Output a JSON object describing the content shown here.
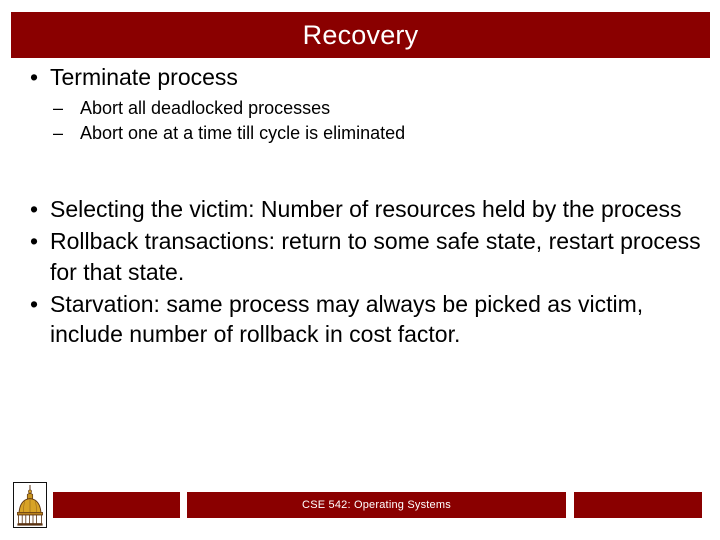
{
  "slide": {
    "title": "Recovery",
    "accent_color": "#8a0000",
    "background_color": "#ffffff",
    "title_text_color": "#ffffff",
    "body_text_color": "#000000"
  },
  "content": {
    "blocks": [
      {
        "level": 1,
        "marker": "•",
        "text": "Terminate process"
      },
      {
        "level": 2,
        "marker": "–",
        "text": "Abort all deadlocked processes"
      },
      {
        "level": 2,
        "marker": "–",
        "text": "Abort one at a time till cycle is eliminated"
      },
      {
        "level": 1,
        "marker": "•",
        "text": "Selecting the victim: Number of resources held by the process"
      },
      {
        "level": 1,
        "marker": "•",
        "text": "Rollback transactions: return to some safe state, restart process for that state."
      },
      {
        "level": 1,
        "marker": "•",
        "text": "Starvation: same process may always be picked as victim, include number of rollback in cost factor."
      }
    ]
  },
  "footer": {
    "center_text": "CSE 542: Operating Systems",
    "logo_name": "golden-dome-building-logo",
    "bar_color": "#8a0000",
    "logo_dome_color": "#d8a326",
    "logo_outline_color": "#5a3210"
  }
}
